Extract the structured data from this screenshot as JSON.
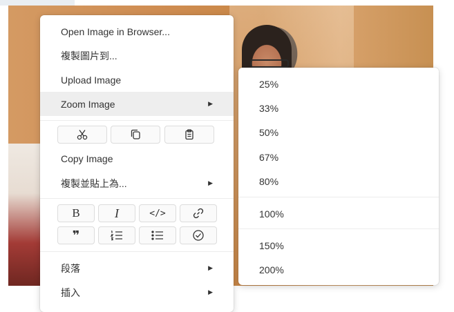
{
  "context_menu": {
    "items_top": [
      {
        "label": "Open Image in Browser..."
      },
      {
        "label": "複製圖片到..."
      },
      {
        "label": "Upload Image"
      },
      {
        "label": "Zoom Image",
        "has_submenu": true,
        "active": true
      }
    ],
    "edit_buttons": [
      {
        "icon": "scissors-icon"
      },
      {
        "icon": "copy-icon"
      },
      {
        "icon": "clipboard-paste-icon"
      }
    ],
    "items_mid": [
      {
        "label": "Copy Image"
      },
      {
        "label": "複製並貼上為...",
        "has_submenu": true
      }
    ],
    "format_buttons": [
      {
        "icon": "bold-icon",
        "glyph": "B"
      },
      {
        "icon": "italic-icon",
        "glyph": "I"
      },
      {
        "icon": "code-icon",
        "glyph": "</>"
      },
      {
        "icon": "link-icon"
      },
      {
        "icon": "quote-icon",
        "glyph": "❞"
      },
      {
        "icon": "ordered-list-icon"
      },
      {
        "icon": "bullet-list-icon"
      },
      {
        "icon": "check-circle-icon"
      }
    ],
    "items_bottom": [
      {
        "label": "段落",
        "has_submenu": true
      },
      {
        "label": "插入",
        "has_submenu": true
      }
    ]
  },
  "zoom_submenu": {
    "group1": [
      "25%",
      "33%",
      "50%",
      "67%",
      "80%"
    ],
    "group2": [
      "100%"
    ],
    "group3": [
      "150%",
      "200%"
    ]
  },
  "submenu_arrow_glyph": "▶"
}
